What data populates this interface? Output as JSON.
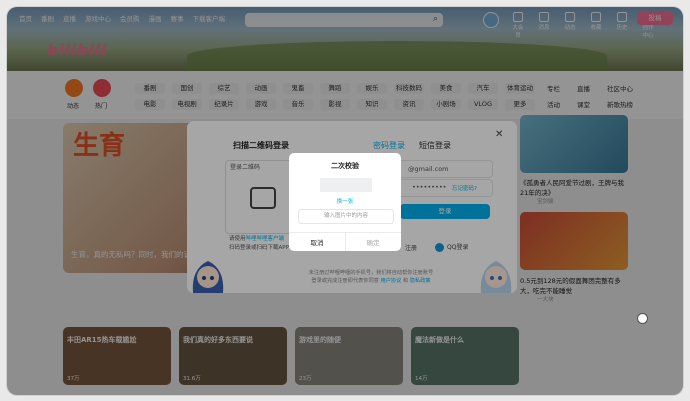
{
  "topnav": [
    "首页",
    "番剧",
    "直播",
    "游戏中心",
    "会员购",
    "漫画",
    "赛事",
    "下载客户端"
  ],
  "header_right": [
    "大会员",
    "消息",
    "动态",
    "收藏",
    "历史",
    "创作中心"
  ],
  "upload_label": "投稿",
  "left_circles": [
    {
      "label": "动态",
      "color": "#ff7f24"
    },
    {
      "label": "热门",
      "color": "#f94f5a"
    }
  ],
  "channels_row1": [
    "番剧",
    "国创",
    "综艺",
    "动画",
    "鬼畜",
    "舞蹈",
    "娱乐",
    "科技数码",
    "美食",
    "汽车",
    "体育运动"
  ],
  "channels_row2": [
    "电影",
    "电视剧",
    "纪录片",
    "游戏",
    "音乐",
    "影视",
    "知识",
    "资讯",
    "小剧场",
    "VLOG",
    "更多"
  ],
  "right_channels": [
    "专栏",
    "直播",
    "活动",
    "课堂",
    "社区中心",
    "新歌热榜"
  ],
  "hero": {
    "text": "生育",
    "caption": "生育，真的无私吗？同时，我们的诉求"
  },
  "right_card": {
    "title": "《孤勇者人民阿爱节过剧，王牌与我21年的决》",
    "meta": "宝剑嫂"
  },
  "right_card2": {
    "title": "0.5元到128元的假面舞团完整有多大，吃完不能睡觉",
    "meta": "一大块"
  },
  "modal": {
    "qr_title": "扫描二维码登录",
    "qr_alt": "登录二维码",
    "qr_hint_1": "请使用",
    "qr_hint_link": "哔哩哔哩客户端",
    "qr_hint_2": "扫码登录或扫码下载APP",
    "tab_password": "密码登录",
    "tab_sms": "短信登录",
    "account_value": "@gmail.com",
    "password_dots": "•••••••••",
    "forgot": "忘记密码?",
    "login_btn": "登录",
    "register_btn": "注册",
    "qq": "QQ登录",
    "footer_1": "未注册过哔哩哔哩的手机号，我们将自动帮你注册账号",
    "footer_2": "登录或完成注册即代表你同意",
    "agreement": "用户协议",
    "and": "和",
    "privacy": "隐私政策"
  },
  "dialog": {
    "title": "二次校验",
    "refresh": "换一张",
    "input_placeholder": "输入图片中的内容",
    "cancel": "取消",
    "confirm": "确定"
  },
  "bottom_cards": [
    {
      "title": "丰田AR15热车载尴尬",
      "meta": "37万",
      "bg": "#7d5a3e"
    },
    {
      "title": "我们真的好多东西要说",
      "meta": "31.6万",
      "bg": "#6a5a44"
    },
    {
      "title": "游戏里的随便",
      "meta": "23万",
      "bg": "#8d8c83"
    },
    {
      "title": "魔法新做是什么",
      "meta": "14万",
      "bg": "#5e7b6f"
    }
  ]
}
